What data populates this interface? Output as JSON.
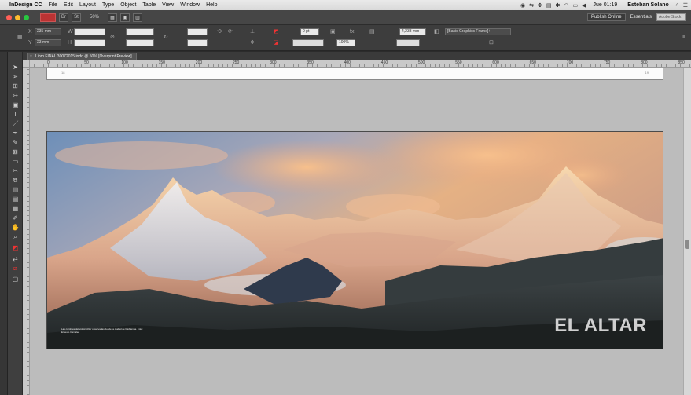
{
  "menubar": {
    "apple": "",
    "app_name": "InDesign CC",
    "menus": [
      "File",
      "Edit",
      "Layout",
      "Type",
      "Object",
      "Table",
      "View",
      "Window",
      "Help"
    ],
    "clock": "Jue 01:19",
    "user": "Esteban Solano"
  },
  "titlebar": {
    "zoom": "50%",
    "publish_online": "Publish Online",
    "workspace": "Essentials",
    "stock_search": "Adobe Stock"
  },
  "control": {
    "x_value": "235 mm",
    "y_value": "23 mm",
    "stroke_weight": "0 pt",
    "opacity": "100%",
    "gap_value": "4,233 mm",
    "frame_style": "[Basic Graphics Frame]+"
  },
  "document_tab": {
    "close": "×",
    "title": "Libro FINAL 30072015.indd @ 50% [Overprint Preview]"
  },
  "ruler": {
    "ticks": [
      "0",
      "50",
      "100",
      "150",
      "200",
      "250",
      "300",
      "350",
      "400",
      "450",
      "500",
      "550",
      "600",
      "650",
      "700",
      "750",
      "800",
      "850"
    ]
  },
  "spread": {
    "title": "EL ALTAR",
    "caption": "Las cumbres del volcán Altar observadas desde la ciudad de Riobamba. Foto: Ernesto Camaleo"
  },
  "colors": {
    "sky_top": "#7d9ec4",
    "sky_glow": "#e9b27f",
    "snow_lit": "#f6d4a8",
    "rock": "#6a3e30",
    "foreground": "#2c3030"
  }
}
